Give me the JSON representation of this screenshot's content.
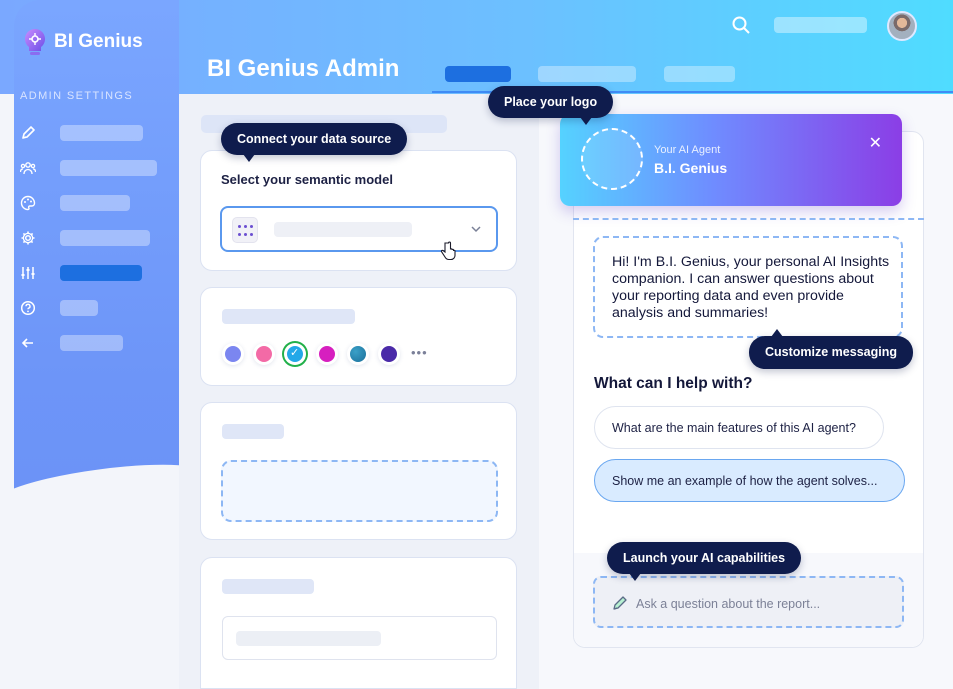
{
  "app": {
    "name": "BI Genius",
    "page_title": "BI Genius Admin"
  },
  "sidebar": {
    "section_label": "ADMIN SETTINGS",
    "items": [
      {
        "icon": "pencil-icon",
        "active": false
      },
      {
        "icon": "users-icon",
        "active": false
      },
      {
        "icon": "palette-icon",
        "active": false
      },
      {
        "icon": "gear-icon",
        "active": false
      },
      {
        "icon": "sliders-icon",
        "active": true
      },
      {
        "icon": "help-icon",
        "active": false
      },
      {
        "icon": "arrow-left-icon",
        "active": false
      }
    ]
  },
  "tooltips": {
    "data_source": "Connect your data source",
    "logo": "Place your logo",
    "messaging": "Customize messaging",
    "capabilities": "Launch your AI capabilities"
  },
  "semantic_card": {
    "title": "Select your semantic model"
  },
  "colors": {
    "swatches": [
      "#7b86f0",
      "#f36aa6",
      "#23a8e8",
      "#d61fbf",
      "#1a6f9a",
      "#4a2aa8"
    ],
    "selected_index": 2,
    "accent": "#1d6fe0",
    "tooltip_bg": "#0f1c4d"
  },
  "agent": {
    "subtitle": "Your AI Agent",
    "name": "B.I. Genius",
    "greeting": "Hi! I'm B.I. Genius, your personal AI Insights companion. I can answer questions about your reporting data and even provide analysis and summaries!",
    "help_heading": "What can I help with?",
    "suggestions": [
      "What are the main features of this AI agent?",
      "Show me an example of how the agent solves..."
    ],
    "input_placeholder": "Ask a question about the report..."
  }
}
